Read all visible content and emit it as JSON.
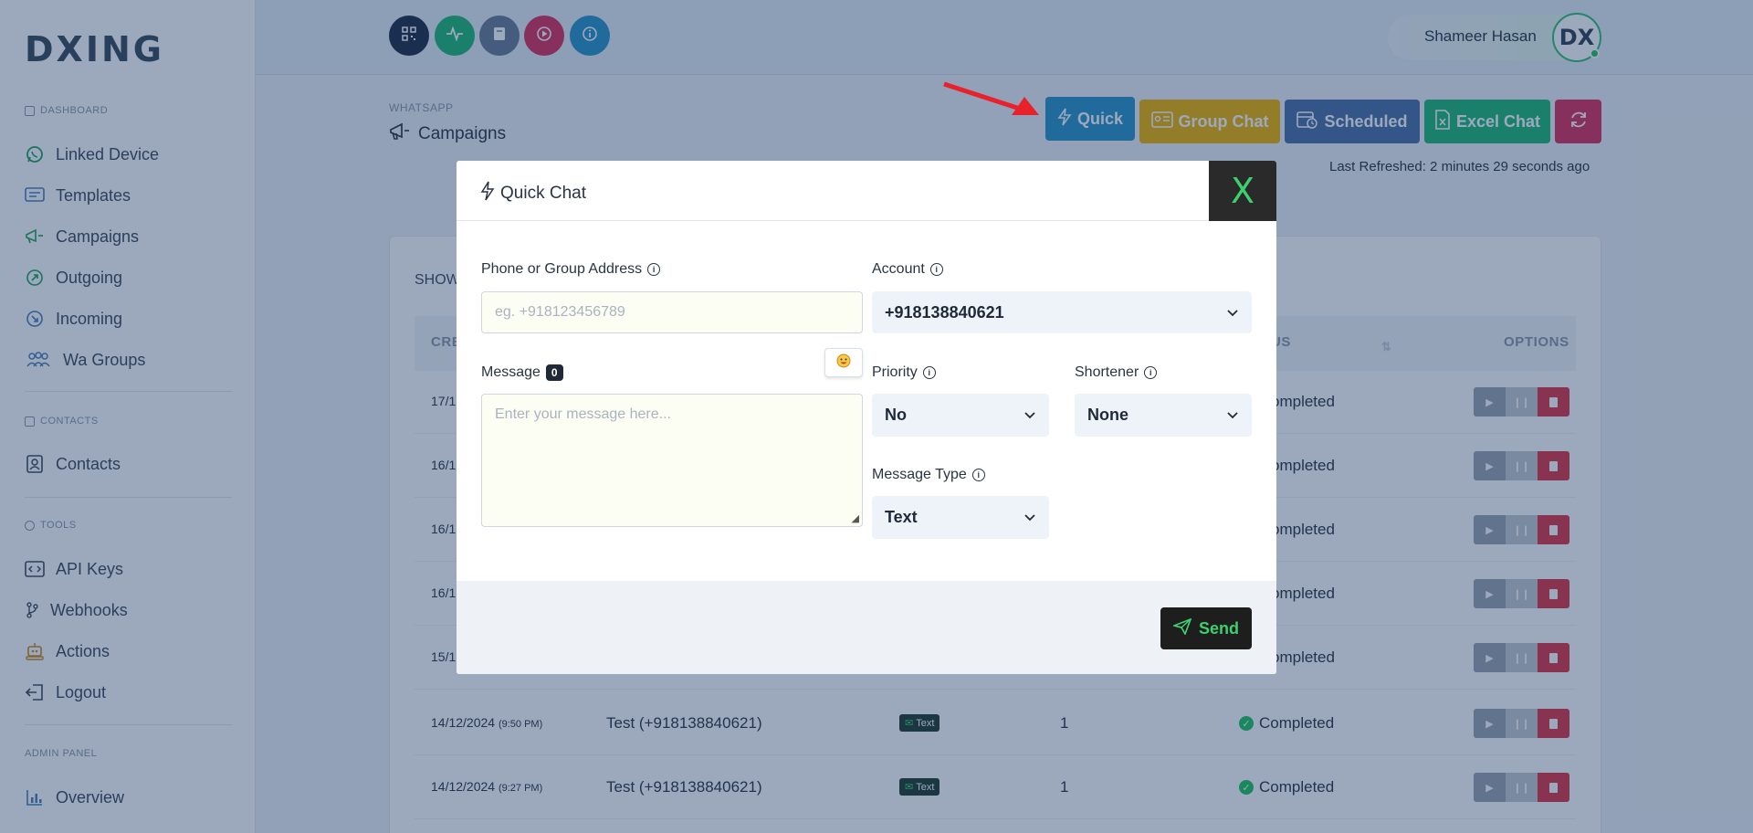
{
  "sidebar": {
    "logo": "DXING",
    "sections": {
      "dashboard": "DASHBOARD",
      "contacts": "CONTACTS",
      "tools": "TOOLS",
      "admin": "ADMIN PANEL"
    },
    "items": {
      "linked_device": "Linked Device",
      "templates": "Templates",
      "campaigns": "Campaigns",
      "outgoing": "Outgoing",
      "incoming": "Incoming",
      "wa_groups": "Wa Groups",
      "contacts": "Contacts",
      "api_keys": "API Keys",
      "webhooks": "Webhooks",
      "actions": "Actions",
      "logout": "Logout",
      "overview": "Overview"
    }
  },
  "topbar": {
    "user_name": "Shameer Hasan",
    "avatar_initials": "DX"
  },
  "header": {
    "crumb": "WHATSAPP",
    "title": "Campaigns",
    "buttons": {
      "quick": "Quick",
      "group_chat": "Group Chat",
      "scheduled": "Scheduled",
      "excel_chat": "Excel Chat"
    },
    "last_refreshed": "Last Refreshed: 2 minutes 29 seconds ago"
  },
  "table": {
    "show_label": "SHOW",
    "headers": {
      "created": "CRE",
      "status": "US",
      "options": "OPTIONS"
    },
    "rows": [
      {
        "date": "17/1",
        "time": "",
        "name": "",
        "type": "",
        "count": "",
        "status": "ompleted"
      },
      {
        "date": "16/1",
        "time": "",
        "name": "",
        "type": "",
        "count": "",
        "status": "ompleted"
      },
      {
        "date": "16/1",
        "time": "",
        "name": "",
        "type": "",
        "count": "",
        "status": "ompleted"
      },
      {
        "date": "16/1",
        "time": "",
        "name": "",
        "type": "",
        "count": "",
        "status": "ompleted"
      },
      {
        "date": "15/1",
        "time": "",
        "name": "",
        "type": "",
        "count": "",
        "status": "ompleted"
      },
      {
        "date": "14/12/2024",
        "time": "(9:50 PM)",
        "name": "Test (+918138840621)",
        "type": "Text",
        "count": "1",
        "status": "Completed"
      },
      {
        "date": "14/12/2024",
        "time": "(9:27 PM)",
        "name": "Test (+918138840621)",
        "type": "Text",
        "count": "1",
        "status": "Completed"
      }
    ]
  },
  "modal": {
    "title": "Quick Chat",
    "close": "X",
    "phone_label": "Phone or Group Address",
    "phone_placeholder": "eg. +918123456789",
    "account_label": "Account",
    "account_value": "+918138840621",
    "message_label": "Message",
    "message_count": "0",
    "message_placeholder": "Enter your message here...",
    "priority_label": "Priority",
    "priority_value": "No",
    "shortener_label": "Shortener",
    "shortener_value": "None",
    "type_label": "Message Type",
    "type_value": "Text",
    "send_label": "Send"
  },
  "colors": {
    "quick": "#2a93c9",
    "group_chat": "#f0b400",
    "scheduled": "#4a6fa5",
    "excel_chat": "#1fb874",
    "refresh": "#dc2f5c",
    "accent_green": "#3ecf6e"
  }
}
